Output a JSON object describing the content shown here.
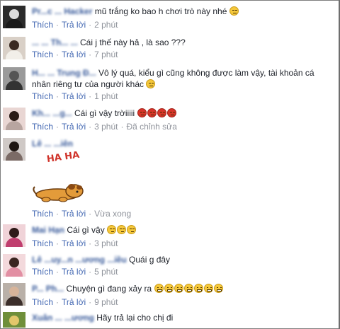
{
  "comments": [
    {
      "name": "Pr...c ... Hacker",
      "text": " mũ trắng ko bao h chơi trò này nhé",
      "emoji": [
        "unamused"
      ],
      "like": "Thích",
      "reply": "Trả lời",
      "time": "2 phút"
    },
    {
      "name": "... ... Th... ...",
      "text": " Cái j thế này hả , là sao ???",
      "emoji": [],
      "like": "Thích",
      "reply": "Trả lời",
      "time": "7 phút"
    },
    {
      "name": "H... ... Trung Đ...",
      "text": " Vô lý quá, kiểu gì cũng không được làm vậy, tài khoản cá nhân riêng tư của người khác",
      "emoji": [
        "unamused"
      ],
      "like": "Thích",
      "reply": "Trả lời",
      "time": "1 phút"
    },
    {
      "name": "Kh... ...g...",
      "text": " Cái gì vậy trờiiiii",
      "emoji": [
        "angry",
        "angry",
        "angry",
        "angry"
      ],
      "like": "Thích",
      "reply": "Trả lời",
      "time": "3 phút",
      "edited": "Đã chỉnh sửa"
    },
    {
      "name": "Lê ... ...iên",
      "text": "",
      "emoji": [],
      "sticker_text": "HA HA",
      "like": "Thích",
      "reply": "Trả lời",
      "time": "Vừa xong"
    },
    {
      "name": "Mai Hạn",
      "text": " Cái gì vậy",
      "emoji": [
        "smirk",
        "smirk",
        "smirk"
      ],
      "like": "Thích",
      "reply": "Trả lời",
      "time": "3 phút"
    },
    {
      "name": "Lê ...uy...n ...ương ...iều",
      "text": " Quái g đây",
      "emoji": [],
      "like": "Thích",
      "reply": "Trả lời",
      "time": "5 phút"
    },
    {
      "name": "P... Ph...",
      "text": " Chuyện gì đang xảy ra",
      "emoji": [
        "grin",
        "grin",
        "grin",
        "grin",
        "grin",
        "grin",
        "grin"
      ],
      "like": "Thích",
      "reply": "Trả lời",
      "time": "9 phút"
    },
    {
      "name": "Xuân ... ...ương",
      "text": " Hãy trả lại cho chị đi",
      "emoji": [],
      "like": "Thích",
      "reply": "Trả lời",
      "time": ""
    }
  ],
  "colors": {
    "name": "#365899",
    "action": "#4267b2",
    "meta": "#90949c",
    "text": "#1d2129",
    "angry": "#d8352a",
    "emoji_yellow": "#f5c83b"
  }
}
